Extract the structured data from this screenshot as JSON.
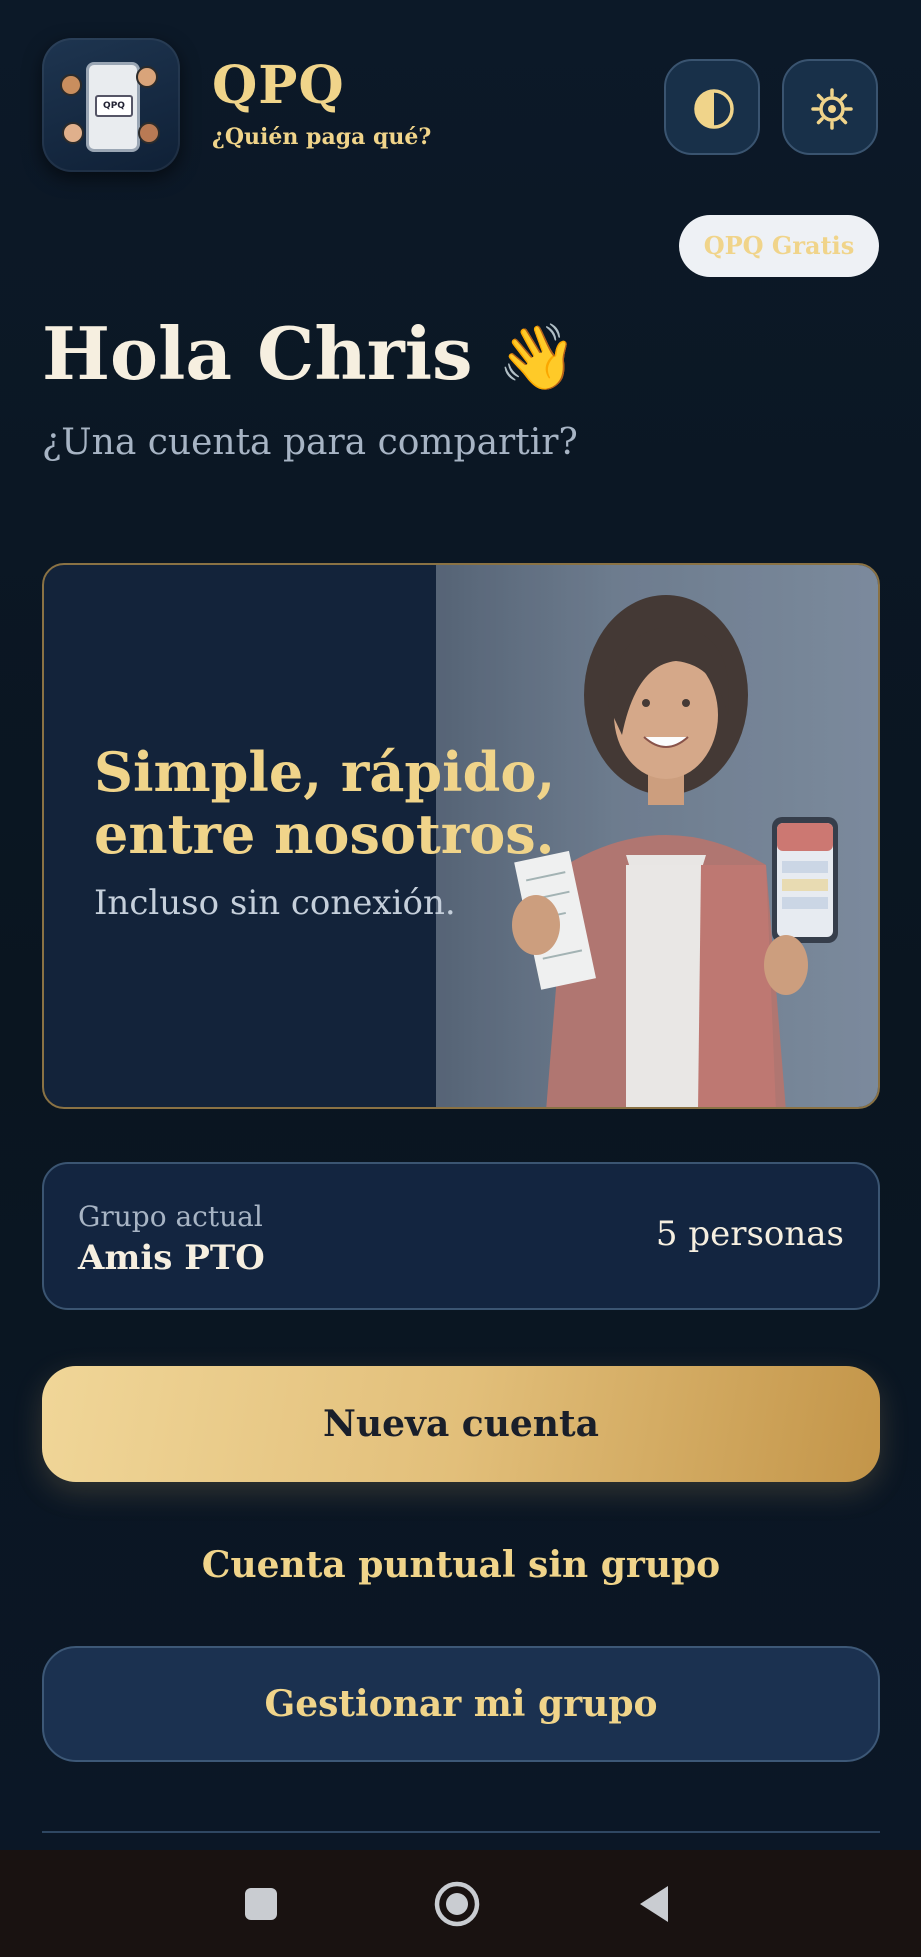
{
  "header": {
    "app_name": "QPQ",
    "tagline": "¿Quién paga qué?",
    "app_icon": "qpq-app-icon",
    "theme_button_icon": "contrast-icon",
    "settings_button_icon": "gear-icon",
    "plan_badge": "QPQ Gratis"
  },
  "greeting": {
    "title": "Hola Chris",
    "emoji": "👋",
    "subtitle": "¿Una cuenta para compartir?"
  },
  "hero": {
    "title": "Simple, rápido, entre nosotros.",
    "subtitle": "Incluso sin conexión.",
    "image": "woman-holding-receipt-and-phone"
  },
  "group": {
    "label": "Grupo actual",
    "name": "Amis PTO",
    "count": "5 personas"
  },
  "actions": {
    "new_bill": "Nueva cuenta",
    "one_time_bill": "Cuenta puntual sin grupo",
    "manage_group": "Gestionar mi grupo"
  },
  "colors": {
    "background": "#0b1624",
    "accent_gold": "#f0d48a",
    "card": "#132540",
    "primary_gradient_start": "#f0d698",
    "primary_gradient_end": "#c39549"
  },
  "system_nav": {
    "recents_icon": "square-icon",
    "home_icon": "circle-icon",
    "back_icon": "triangle-back-icon"
  }
}
